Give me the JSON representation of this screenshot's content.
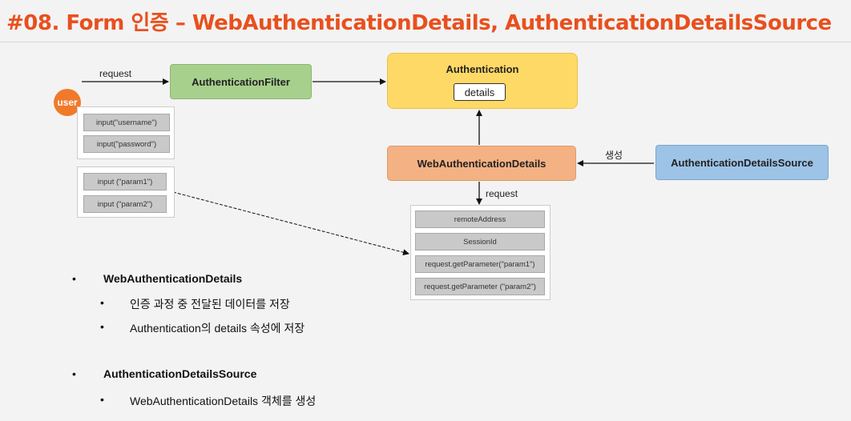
{
  "title": "#08. Form 인증 – WebAuthenticationDetails, AuthenticationDetailsSource",
  "diagram": {
    "user": "user",
    "request_label": "request",
    "authentication_filter": "AuthenticationFilter",
    "authentication": "Authentication",
    "details": "details",
    "web_authentication_details": "WebAuthenticationDetails",
    "authentication_details_source": "AuthenticationDetailsSource",
    "create_label": "생성",
    "request_label_2": "request",
    "form_inputs_1": [
      "input(\"username\")",
      "input(\"password\")"
    ],
    "form_inputs_2": [
      "input (\"param1\")",
      "input (\"param2\")"
    ],
    "request_items": [
      "remoteAddress",
      "SessionId",
      "request.getParameter(\"param1\")",
      "request.getParameter (\"param2\")"
    ]
  },
  "bullets": [
    {
      "heading": "WebAuthenticationDetails",
      "items": [
        "인증 과정 중 전달된 데이터를 저장",
        "Authentication의 details 속성에 저장"
      ]
    },
    {
      "heading": "AuthenticationDetailsSource",
      "items": [
        "WebAuthenticationDetails 객체를 생성"
      ]
    }
  ],
  "colors": {
    "title": "#e8501e",
    "user": "#f07a2a",
    "filter": "#a8d08d",
    "authentication": "#ffd966",
    "web_authentication_details": "#f4b183",
    "authentication_details_source": "#9dc3e6"
  }
}
